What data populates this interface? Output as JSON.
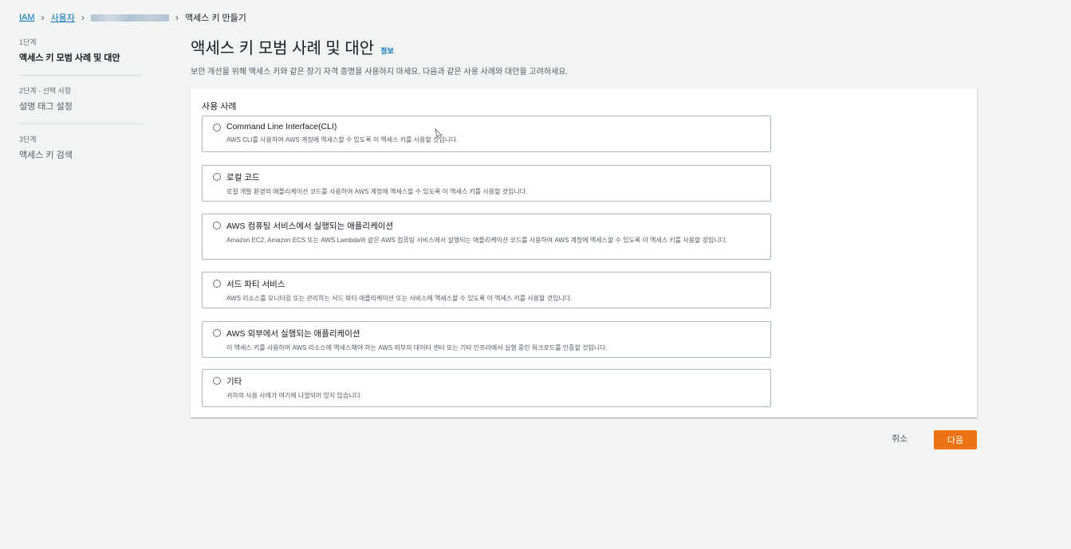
{
  "breadcrumb": {
    "items": [
      "IAM",
      "사용자",
      "",
      "액세스 키 만들기"
    ]
  },
  "steps": [
    {
      "num": "1단계",
      "title": "액세스 키 모범 사례 및 대안"
    },
    {
      "num": "2단계 - 선택 사항",
      "title": "설명 태그 설정"
    },
    {
      "num": "3단계",
      "title": "액세스 키 검색"
    }
  ],
  "header": {
    "title": "액세스 키 모범 사례 및 대안",
    "info": "정보",
    "description": "보안 개선을 위해 액세스 키와 같은 장기 자격 증명을 사용하지 마세요. 다음과 같은 사용 사례와 대안을 고려하세요."
  },
  "use_case": {
    "label": "사용 사례",
    "options": [
      {
        "title": "Command Line Interface(CLI)",
        "desc": "AWS CLI를 사용하여 AWS 계정에 액세스할 수 있도록 이 액세스 키를 사용할 것입니다."
      },
      {
        "title": "로컬 코드",
        "desc": "로컬 개발 환경의 애플리케이션 코드를 사용하여 AWS 계정에 액세스할 수 있도록 이 액세스 키를 사용할 것입니다."
      },
      {
        "title": "AWS 컴퓨팅 서비스에서 실행되는 애플리케이션",
        "desc": "Amazon EC2, Amazon ECS 또는 AWS Lambda와 같은 AWS 컴퓨팅 서비스에서 실행되는 애플리케이션 코드를 사용하여 AWS 계정에 액세스할 수 있도록 이 액세스 키를 사용할 것입니다."
      },
      {
        "title": "서드 파티 서비스",
        "desc": "AWS 리소스를 모니터링 또는 관리하는 서드 파티 애플리케이션 또는 서비스에 액세스할 수 있도록 이 액세스 키를 사용할 것입니다."
      },
      {
        "title": "AWS 외부에서 실행되는 애플리케이션",
        "desc": "이 액세스 키를 사용하여 AWS 리소스에 액세스해야 하는 AWS 외부의 데이터 센터 또는 기타 인프라에서 실행 중인 워크로드를 인증할 것입니다."
      },
      {
        "title": "기타",
        "desc": "귀하의 사용 사례가 여기에 나열되어 있지 않습니다."
      }
    ]
  },
  "footer": {
    "cancel": "취소",
    "next": "다음"
  },
  "colors": {
    "accent": "#ec7211",
    "link": "#0073bb",
    "background": "#f2f3f3"
  }
}
